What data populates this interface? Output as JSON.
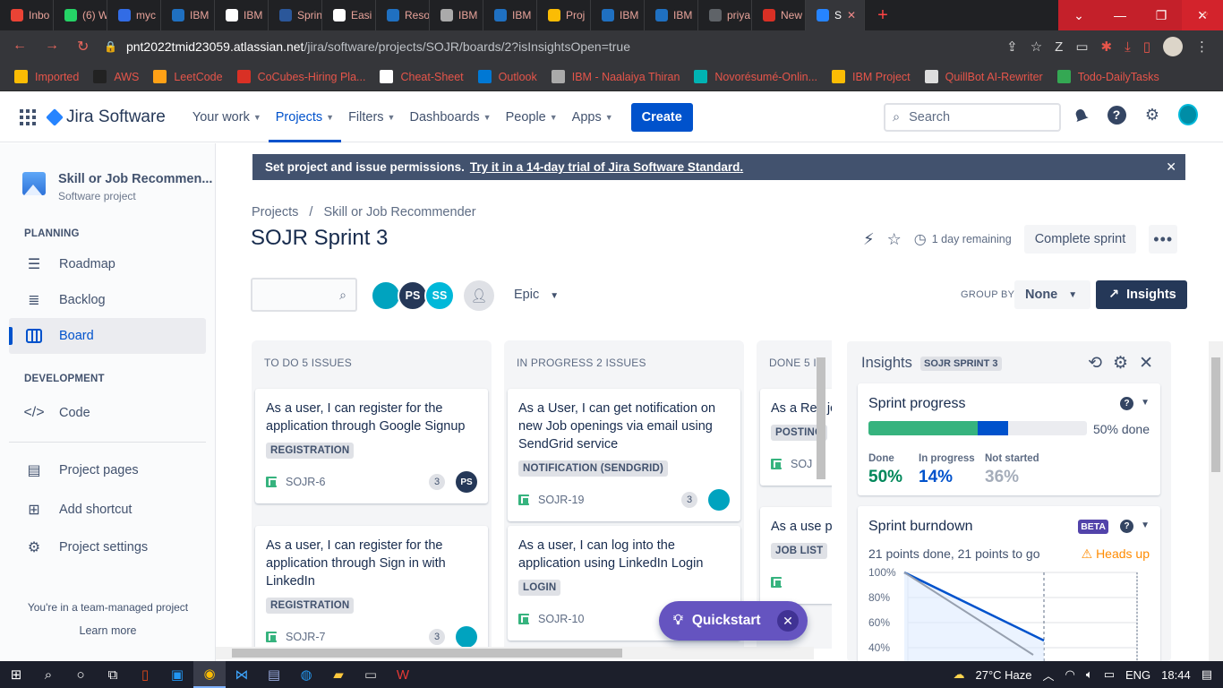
{
  "browser": {
    "tabs": [
      {
        "label": "Inbo",
        "color": "#ea4335"
      },
      {
        "label": "(6) W",
        "color": "#25d366"
      },
      {
        "label": "myc",
        "color": "#326ce5"
      },
      {
        "label": "IBM",
        "color": "#1f70c1"
      },
      {
        "label": "IBM",
        "color": "#ffffff"
      },
      {
        "label": "Sprin",
        "color": "#2b579a"
      },
      {
        "label": "Easi",
        "color": "#ffffff"
      },
      {
        "label": "Reso",
        "color": "#1f70c1"
      },
      {
        "label": "IBM",
        "color": "#aaaaaa"
      },
      {
        "label": "IBM",
        "color": "#1f70c1"
      },
      {
        "label": "Proj",
        "color": "#fbbc04"
      },
      {
        "label": "IBM",
        "color": "#1f70c1"
      },
      {
        "label": "IBM",
        "color": "#1f70c1"
      },
      {
        "label": "priya",
        "color": "#5f6368"
      },
      {
        "label": "New",
        "color": "#d93025"
      },
      {
        "label": "S",
        "color": "#2684ff",
        "active": true
      }
    ],
    "url_host": "pnt2022tmid23059.atlassian.net",
    "url_path": "/jira/software/projects/SOJR/boards/2?isInsightsOpen=true",
    "bookmarks": [
      {
        "label": "Imported",
        "color": "#fbbc04"
      },
      {
        "label": "AWS",
        "color": "#222222"
      },
      {
        "label": "LeetCode",
        "color": "#ffa116"
      },
      {
        "label": "CoCubes-Hiring Pla...",
        "color": "#d93025"
      },
      {
        "label": "Cheat-Sheet",
        "color": "#ffffff"
      },
      {
        "label": "Outlook",
        "color": "#0078d4"
      },
      {
        "label": "IBM - Naalaiya Thiran",
        "color": "#aaaaaa"
      },
      {
        "label": "Novorésumé-Onlin...",
        "color": "#00b3b3"
      },
      {
        "label": "IBM Project",
        "color": "#fbbc04"
      },
      {
        "label": "QuillBot AI-Rewriter",
        "color": "#dddddd"
      },
      {
        "label": "Todo-DailyTasks",
        "color": "#34a853"
      }
    ]
  },
  "nav": {
    "product": "Jira Software",
    "menu": [
      {
        "label": "Your work",
        "active": false
      },
      {
        "label": "Projects",
        "active": true
      },
      {
        "label": "Filters",
        "active": false
      },
      {
        "label": "Dashboards",
        "active": false
      },
      {
        "label": "People",
        "active": false
      },
      {
        "label": "Apps",
        "active": false
      }
    ],
    "create": "Create",
    "search_placeholder": "Search"
  },
  "sidebar": {
    "project_name": "Skill or Job Recommen...",
    "project_type": "Software project",
    "planning_heading": "PLANNING",
    "development_heading": "DEVELOPMENT",
    "items": {
      "roadmap": "Roadmap",
      "backlog": "Backlog",
      "board": "Board",
      "code": "Code",
      "pages": "Project pages",
      "shortcut": "Add shortcut",
      "settings": "Project settings"
    },
    "team_note": "You're in a team-managed project",
    "learn_more": "Learn more"
  },
  "banner": {
    "text": "Set project and issue permissions.",
    "link": "Try it in a 14-day trial of Jira Software Standard."
  },
  "breadcrumb": {
    "root": "Projects",
    "project": "Skill or Job Recommender"
  },
  "sprint": {
    "title": "SOJR Sprint 3",
    "remaining": "1 day remaining",
    "complete": "Complete sprint"
  },
  "filters": {
    "avatars": [
      {
        "initials": "",
        "color": "#00a3bf"
      },
      {
        "initials": "PS",
        "color": "#253858"
      },
      {
        "initials": "SS",
        "color": "#00b8d9"
      }
    ],
    "epic": "Epic",
    "group_by_label": "GROUP BY",
    "group_by_value": "None",
    "insights_button": "Insights"
  },
  "columns": [
    {
      "title": "TO DO 5 ISSUES",
      "cards": [
        {
          "summary": "As a user, I can register for the application through Google Signup",
          "label": "REGISTRATION",
          "key": "SOJR-6",
          "points": "3",
          "assignee": "PS",
          "assignee_color": "#253858"
        },
        {
          "summary": "As a user, I can register for the application through Sign in with LinkedIn",
          "label": "REGISTRATION",
          "key": "SOJR-7",
          "points": "3",
          "assignee": "",
          "assignee_color": "#00a3bf"
        }
      ]
    },
    {
      "title": "IN PROGRESS 2 ISSUES",
      "cards": [
        {
          "summary": "As a User, I can get notification on new Job openings via email using SendGrid service",
          "label": "NOTIFICATION (SENDGRID)",
          "key": "SOJR-19",
          "points": "3",
          "assignee": "",
          "assignee_color": "#00a3bf"
        },
        {
          "summary": "As a user, I can log into the application using LinkedIn Login",
          "label": "LOGIN",
          "key": "SOJR-10",
          "points": "",
          "assignee": "",
          "assignee_color": ""
        }
      ]
    },
    {
      "title": "DONE 5 I",
      "cards": [
        {
          "summary": "As a Rec job ope",
          "label": "POSTINC",
          "key": "SOJ",
          "points": "",
          "assignee": "",
          "assignee_color": ""
        },
        {
          "summary": "As a use posted Job Sea",
          "label": "JOB LIST",
          "key": "",
          "points": "",
          "assignee": "",
          "assignee_color": ""
        }
      ]
    }
  ],
  "quickstart": "Quickstart",
  "insights": {
    "title": "Insights",
    "sprint_tag": "SOJR SPRINT 3",
    "progress": {
      "title": "Sprint progress",
      "done_text": "50% done",
      "done_fraction": 0.5,
      "in_progress_fraction": 0.14,
      "stats": [
        {
          "label": "Done",
          "value": "50%",
          "color": "#00875a"
        },
        {
          "label": "In progress",
          "value": "14%",
          "color": "#0052cc"
        },
        {
          "label": "Not started",
          "value": "36%",
          "color": "#a5adba"
        }
      ]
    },
    "burndown": {
      "title": "Sprint burndown",
      "beta": "BETA",
      "subtitle": "21 points done, 21 points to go",
      "heads_up": "Heads up",
      "y_ticks": [
        "100%",
        "80%",
        "60%",
        "40%"
      ]
    }
  },
  "taskbar": {
    "weather": "27°C  Haze",
    "lang": "ENG",
    "time": "18:44"
  }
}
